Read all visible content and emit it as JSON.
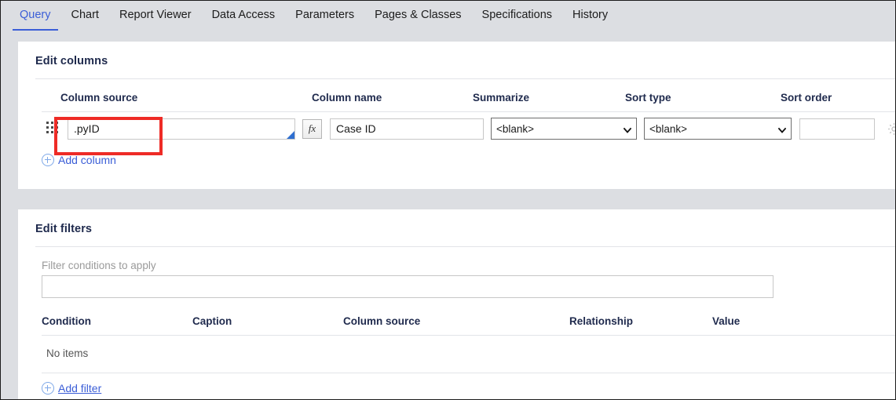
{
  "tabs": [
    {
      "label": "Query",
      "active": true
    },
    {
      "label": "Chart",
      "active": false
    },
    {
      "label": "Report Viewer",
      "active": false
    },
    {
      "label": "Data Access",
      "active": false
    },
    {
      "label": "Parameters",
      "active": false
    },
    {
      "label": "Pages & Classes",
      "active": false
    },
    {
      "label": "Specifications",
      "active": false
    },
    {
      "label": "History",
      "active": false
    }
  ],
  "columns_panel": {
    "title": "Edit columns",
    "headers": {
      "column_source": "Column source",
      "column_name": "Column name",
      "summarize": "Summarize",
      "sort_type": "Sort type",
      "sort_order": "Sort order"
    },
    "row": {
      "drag_handle_icon": "drag-dots-icon",
      "column_source_value": ".pyID",
      "column_source_placeholder": "",
      "fx_button_label": "fx",
      "column_name_value": "Case ID",
      "column_name_placeholder": "",
      "summarize_value": "<blank>",
      "summarize_options": [
        "<blank>"
      ],
      "sort_type_value": "<blank>",
      "sort_type_options": [
        "<blank>"
      ],
      "sort_order_value": "",
      "sort_order_placeholder": "",
      "gear_icon": "gear-icon",
      "delete_icon": "trash-icon"
    },
    "add_column_label": "Add column",
    "add_column_icon": "circle-plus-icon"
  },
  "filters_panel": {
    "title": "Edit filters",
    "filter_conditions_label": "Filter conditions to apply",
    "filter_conditions_value": "",
    "filter_conditions_placeholder": "",
    "headers": {
      "condition": "Condition",
      "caption": "Caption",
      "column_source": "Column source",
      "relationship": "Relationship",
      "value": "Value"
    },
    "empty_text": "No items",
    "add_filter_label": "Add filter",
    "add_filter_icon": "circle-plus-icon"
  },
  "annotation": {
    "highlight_color": "#ee2b26",
    "target": "column-source-input"
  },
  "theme": {
    "accent": "#3b5ed7",
    "heading": "#1f2a4d",
    "chrome_bg": "#dcdee2",
    "panel_bg": "#ffffff",
    "resize_handle": "#2f6fd0"
  }
}
